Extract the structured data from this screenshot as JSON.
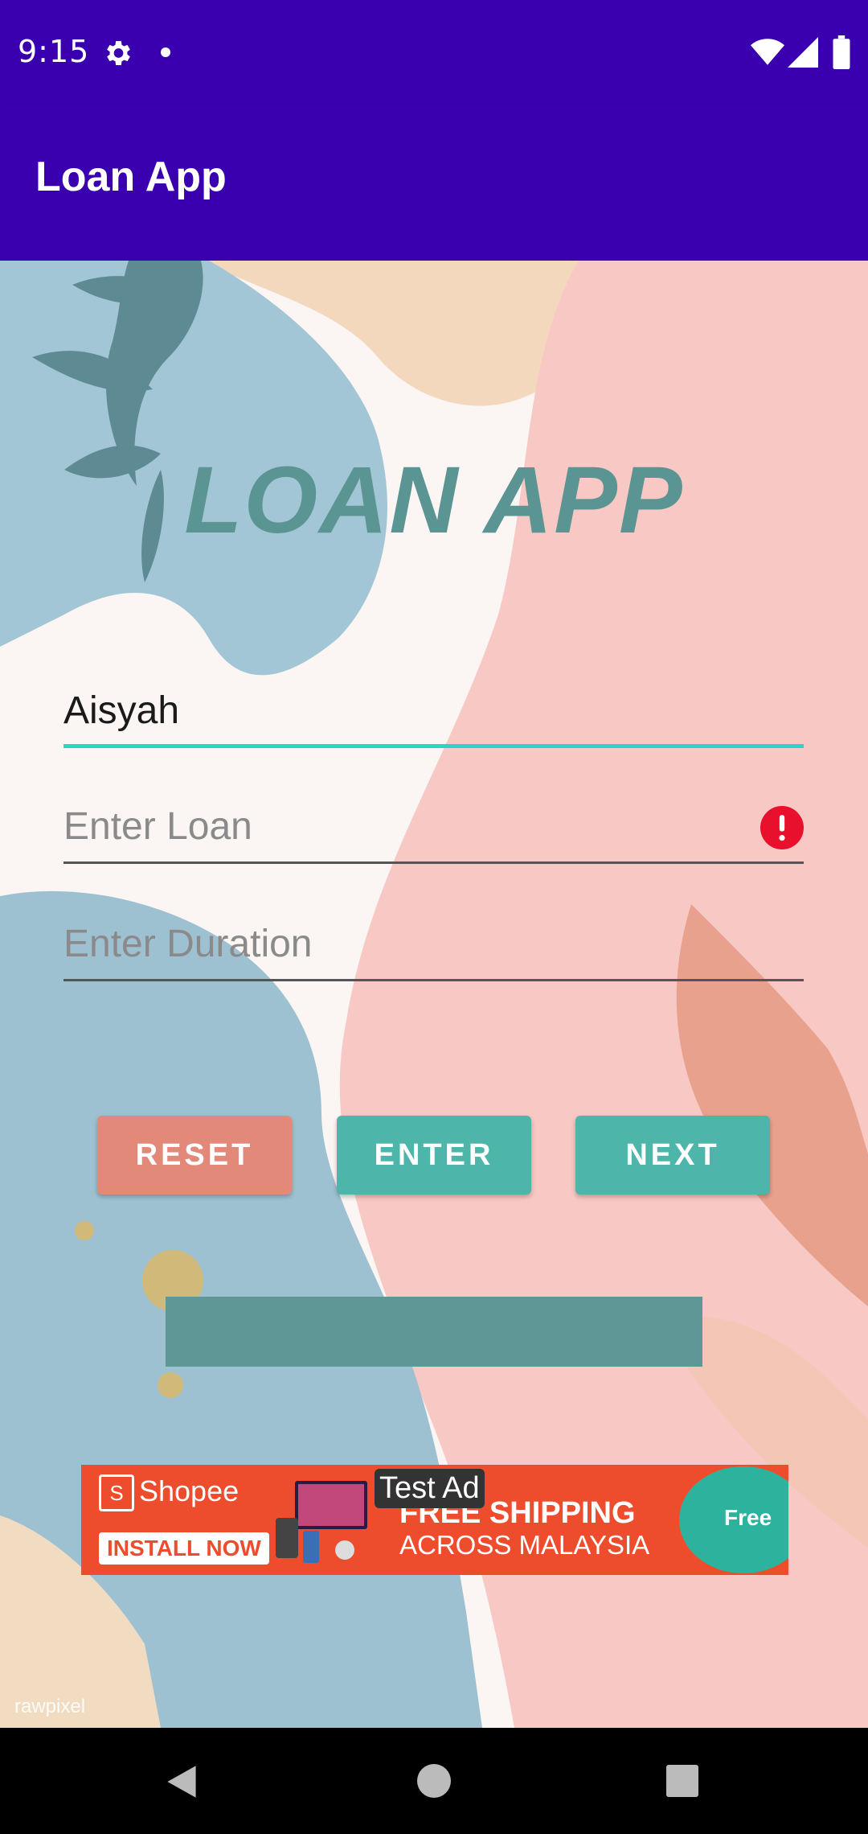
{
  "status_bar": {
    "time": "9:15"
  },
  "app_bar": {
    "title": "Loan App"
  },
  "main": {
    "heading": "LOAN APP",
    "name_field": {
      "value": "Aisyah"
    },
    "loan_field": {
      "placeholder": "Enter Loan"
    },
    "duration_field": {
      "placeholder": "Enter Duration"
    },
    "buttons": {
      "reset": "RESET",
      "enter": "ENTER",
      "next": "NEXT"
    },
    "result": ""
  },
  "ad": {
    "brand": "Shopee",
    "cta": "INSTALL NOW",
    "headline_1": "FREE SHIPPING",
    "headline_2": "ACROSS MALAYSIA",
    "badge": "Free",
    "label": "Test Ad"
  },
  "watermark": "rawpixel",
  "colors": {
    "app_bar": "#3a00b0",
    "heading": "#5b9593",
    "focus_line": "#2dd4bf",
    "reset_button": "#e2897a",
    "primary_button": "#4eb5aa",
    "error_icon": "#e8102c"
  },
  "icons": {
    "status": [
      "gear-icon",
      "dot-icon",
      "wifi-icon",
      "signal-icon",
      "battery-icon"
    ],
    "field_error": "error-icon",
    "navigation": [
      "back-icon",
      "home-icon",
      "recents-icon"
    ]
  }
}
